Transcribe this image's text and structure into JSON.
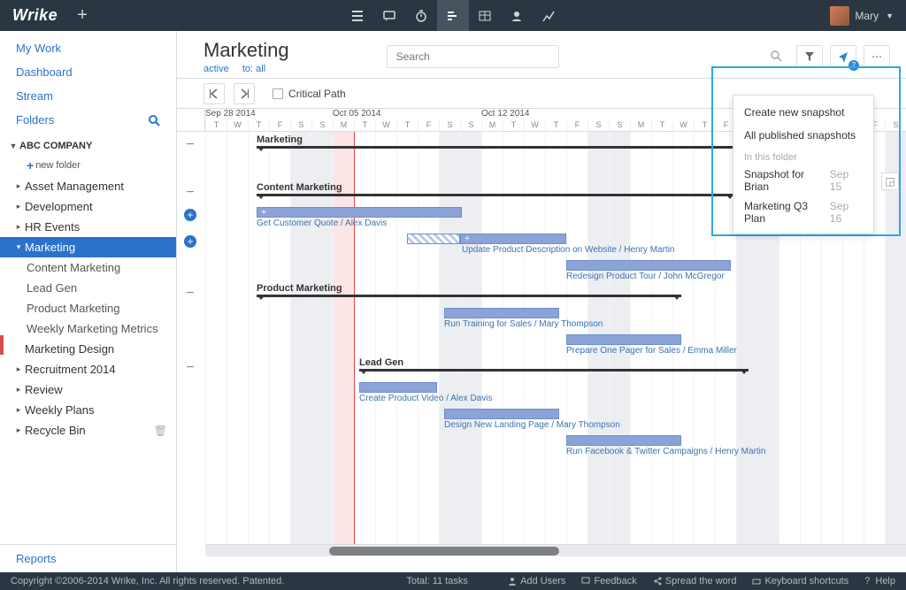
{
  "header": {
    "logo": "Wrike",
    "user_name": "Mary"
  },
  "sidebar": {
    "my_work": "My Work",
    "dashboard": "Dashboard",
    "stream": "Stream",
    "folders": "Folders",
    "company": "ABC COMPANY",
    "new_folder": "new folder",
    "nodes": {
      "asset_mgmt": "Asset Management",
      "development": "Development",
      "hr_events": "HR Events",
      "marketing": "Marketing",
      "content_marketing": "Content Marketing",
      "lead_gen": "Lead Gen",
      "product_marketing": "Product Marketing",
      "weekly_metrics": "Weekly Marketing Metrics",
      "marketing_design": "Marketing Design",
      "recruitment": "Recruitment 2014",
      "review": "Review",
      "weekly_plans": "Weekly Plans",
      "recycle_bin": "Recycle Bin"
    },
    "reports": "Reports"
  },
  "pane": {
    "title": "Marketing",
    "sub_active": "active",
    "sub_to": "to: all",
    "search_placeholder": "Search",
    "share_badge": "2"
  },
  "toolbar": {
    "critical_path": "Critical Path"
  },
  "timeline": {
    "weeks": [
      "Sep 28 2014",
      "Oct 05 2014",
      "Oct 12 2014"
    ],
    "days": [
      "T",
      "W",
      "T",
      "F",
      "S",
      "S",
      "M",
      "T",
      "W",
      "T",
      "F",
      "S",
      "S",
      "M",
      "T",
      "W",
      "T",
      "F",
      "S",
      "S",
      "M",
      "T",
      "W",
      "T",
      "F",
      "S",
      "S",
      "M",
      "T",
      "W",
      "T",
      "F",
      "S"
    ],
    "groups": {
      "marketing": "Marketing",
      "content": "Content Marketing",
      "product": "Product Marketing",
      "leadgen": "Lead Gen"
    },
    "tasks": {
      "t1": "Get Customer Quote / Alex Davis",
      "t2": "Update Product Description on Website / Henry Martin",
      "t3": "Redesign Product Tour / John McGregor",
      "t4": "Run Training for Sales / Mary Thompson",
      "t5": "Prepare One Pager for Sales / Emma Miller",
      "t6": "Create Product Video / Alex Davis",
      "t7": "Design New Landing Page / Mary Thompson",
      "t8": "Run Facebook & Twitter Campaigns / Henry Martin"
    }
  },
  "dropdown": {
    "create": "Create new snapshot",
    "published": "All published snapshots",
    "in_folder": "In this folder",
    "snaps": [
      {
        "name": "Snapshot for Brian",
        "date": "Sep 15"
      },
      {
        "name": "Marketing Q3 Plan",
        "date": "Sep 16"
      }
    ]
  },
  "footer": {
    "copyright": "Copyright ©2006-2014 Wrike, Inc. All rights reserved. Patented.",
    "total": "Total: 11 tasks",
    "add_users": "Add Users",
    "feedback": "Feedback",
    "spread": "Spread the word",
    "shortcuts": "Keyboard shortcuts",
    "help": "Help"
  }
}
